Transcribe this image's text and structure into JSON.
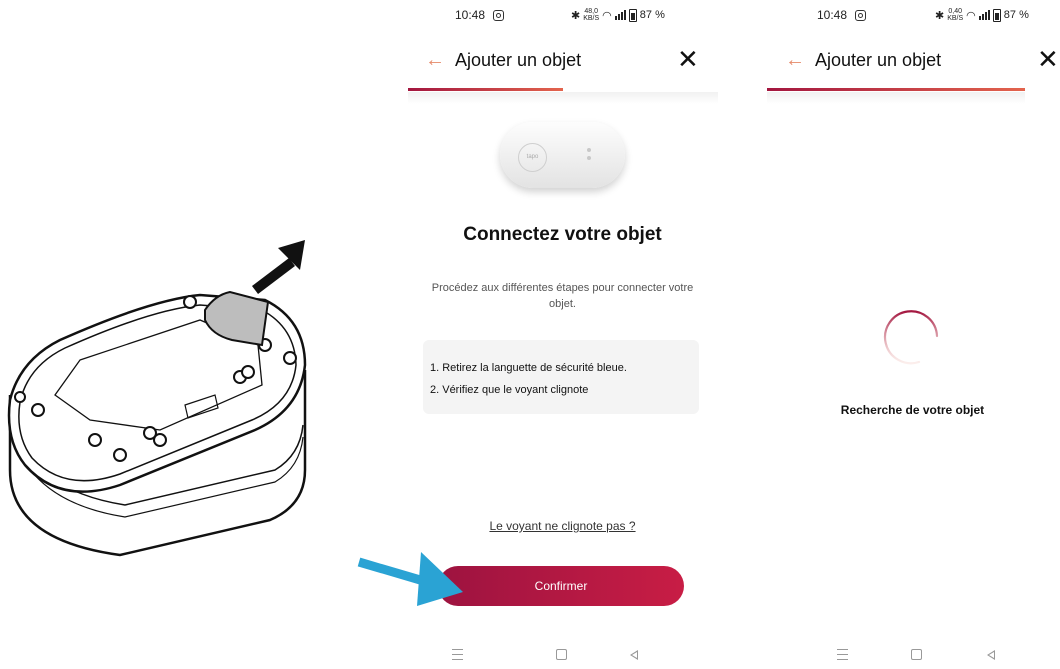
{
  "colors": {
    "accent": "#a3163f",
    "accent_light": "#e3644d",
    "back_arrow": "#e68a6a",
    "highlight_arrow": "#2aa3d4",
    "card_bg": "#f4f4f4"
  },
  "illustration": {
    "description_icon": "device-remove-tab-illustration",
    "arrow_icon": "up-right-arrow-icon"
  },
  "screen1": {
    "status": {
      "time": "10:48",
      "speed_top": "48,0",
      "speed_unit": "KB/S",
      "battery": "87 %"
    },
    "appbar": {
      "back_icon": "←",
      "title": "Ajouter un objet",
      "close_icon": "✕"
    },
    "progress": 0.5,
    "device_logo_text": "tapo",
    "heading": "Connectez votre objet",
    "subtitle": "Procédez aux différentes étapes pour connecter votre objet.",
    "steps": [
      "1. Retirez la languette de sécurité bleue.",
      "2. Vérifiez que le voyant clignote"
    ],
    "help_link": "Le voyant ne clignote pas ?",
    "confirm_label": "Confirmer"
  },
  "screen2": {
    "status": {
      "time": "10:48",
      "speed_top": "0,40",
      "speed_unit": "KB/S",
      "battery": "87 %"
    },
    "appbar": {
      "back_icon": "←",
      "title": "Ajouter un objet",
      "close_icon": "✕"
    },
    "progress": 1.0,
    "searching_text": "Recherche de votre objet"
  }
}
